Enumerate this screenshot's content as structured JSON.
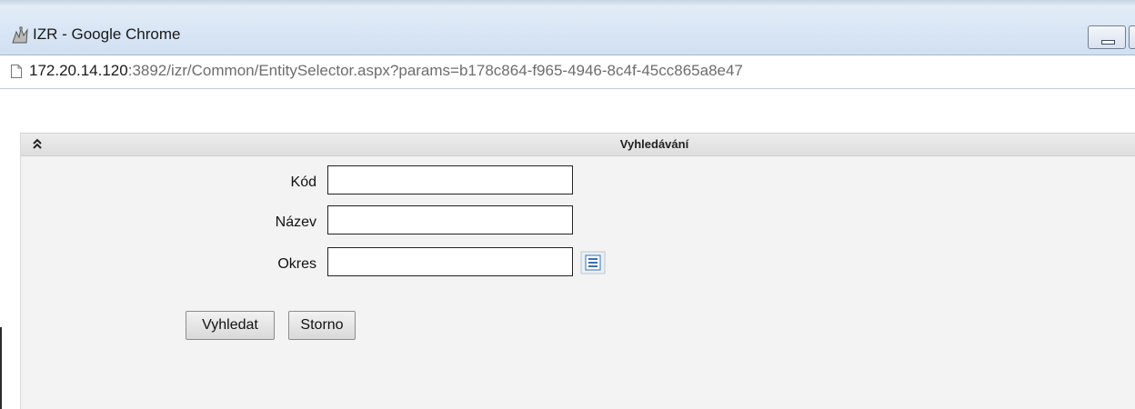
{
  "window": {
    "title": "IZR - Google Chrome",
    "app_icon": "app-icon"
  },
  "address": {
    "page_icon": "page-icon",
    "host": "172.20.14.120",
    "rest": ":3892/izr/Common/EntitySelector.aspx?params=b178c864-f965-4946-8c4f-45cc865a8e47"
  },
  "panel": {
    "title": "Vyhledávání",
    "collapse_icon": "double-chevron-up-icon"
  },
  "form": {
    "fields": [
      {
        "label": "Kód",
        "value": ""
      },
      {
        "label": "Název",
        "value": ""
      },
      {
        "label": "Okres",
        "value": ""
      }
    ],
    "picker_icon": "list-picker-icon"
  },
  "buttons": {
    "search": "Vyhledat",
    "cancel": "Storno"
  },
  "colors": {
    "titlebar": "#d9e6f5",
    "panel_bg": "#f3f3f3",
    "panel_header": "#e4e4e4",
    "picker_icon": "#3a6fb0"
  }
}
